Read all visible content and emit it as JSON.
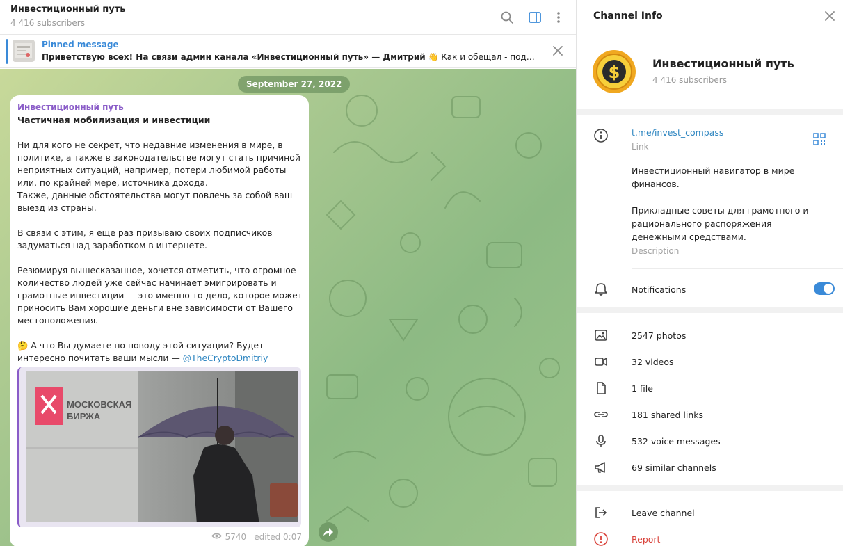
{
  "chat": {
    "title": "Инвестиционный путь",
    "subscribers": "4 416 subscribers",
    "pinned": {
      "label": "Pinned message",
      "text_bold": "Приветствую всех! На связи админ канала «Инвестиционный путь» — Дмитрий",
      "emoji": "👋",
      "text_rest": "Как и обещал - поделю..."
    },
    "date_pill": "September 27, 2022",
    "message": {
      "author": "Инвестиционный путь",
      "title": "Частичная мобилизация и инвестиции",
      "p1": "Ни для кого не секрет, что недавние изменения в мире, в политике, а также в законодательстве могут стать причиной неприятных ситуаций, например, потери любимой работы или, по крайней мере, источника дохода.",
      "p1b": "Также, данные обстоятельства могут повлечь за собой ваш выезд из страны.",
      "p2": "В связи с этим, я еще раз призываю своих подписчиков задуматься над заработком в интернете.",
      "p3": "Резюмируя вышесказанное, хочется отметить, что огромное количество людей уже сейчас начинает эмигрировать и грамотные инвестиции — это именно то дело, которое может приносить Вам хорошие деньги вне зависимости от Вашего местоположения.",
      "p4_emoji": "🤔",
      "p4": "А что Вы думаете по поводу этой ситуации? Будет интересно почитать ваши мысли —",
      "mention": "@TheCryptoDmitriy",
      "photo_sign_line1": "МОСКОВСКАЯ",
      "photo_sign_line2": "БИРЖА",
      "views": "5740",
      "edited": "edited 0:07"
    }
  },
  "info": {
    "title": "Channel Info",
    "channel_name": "Инвестиционный путь",
    "subscribers": "4 416 subscribers",
    "link": "t.me/invest_compass",
    "link_label": "Link",
    "description_p1": "Инвестиционный навигатор в мире финансов.",
    "description_p2": "Прикладные советы для грамотного и рационального распоряжения денежными средствами.",
    "description_label": "Description",
    "notifications": "Notifications",
    "notifications_on": true,
    "stats": {
      "photos": "2547 photos",
      "videos": "32 videos",
      "files": "1 file",
      "links": "181 shared links",
      "voice": "532 voice messages",
      "similar": "69 similar channels"
    },
    "leave": "Leave channel",
    "report": "Report"
  },
  "colors": {
    "accent": "#3a8ad8",
    "author": "#8a5cc8",
    "danger": "#d9423a"
  }
}
